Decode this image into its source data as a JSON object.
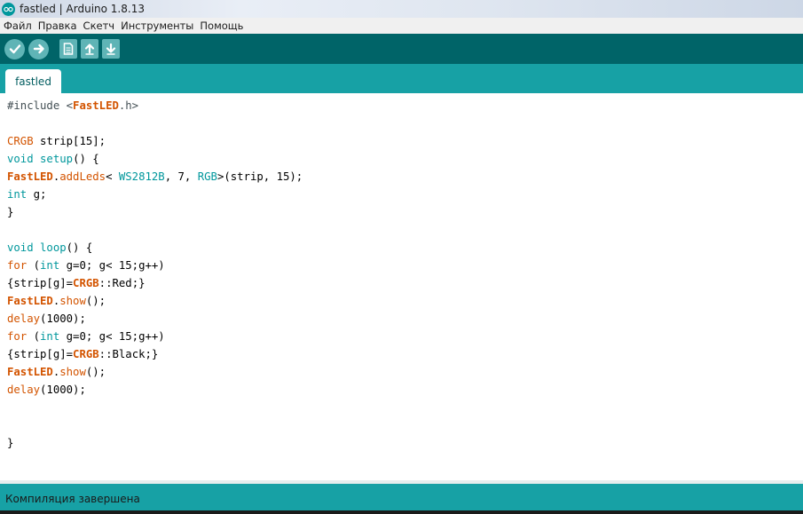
{
  "window": {
    "title": "fastled | Arduino 1.8.13"
  },
  "menu": {
    "items": [
      "Файл",
      "Правка",
      "Скетч",
      "Инструменты",
      "Помощь"
    ]
  },
  "toolbar": {
    "buttons": [
      {
        "name": "verify",
        "icon": "check-icon"
      },
      {
        "name": "upload",
        "icon": "arrow-right-icon"
      },
      {
        "name": "new",
        "icon": "new-file-icon"
      },
      {
        "name": "open",
        "icon": "arrow-up-icon"
      },
      {
        "name": "save",
        "icon": "arrow-down-icon"
      }
    ]
  },
  "tabs": [
    {
      "label": "fastled"
    }
  ],
  "code": {
    "lines": [
      "#include <FastLED.h>",
      "",
      "CRGB strip[15];",
      "void setup() {",
      "FastLED.addLeds< WS2812B, 7, RGB>(strip, 15);",
      "int g;",
      "}",
      "",
      "void loop() {",
      "for (int g=0; g< 15;g++)",
      "{strip[g]=CRGB::Red;}",
      "FastLED.show();",
      "delay(1000);",
      "for (int g=0; g< 15;g++)",
      "{strip[g]=CRGB::Black;}",
      "FastLED.show();",
      "delay(1000);",
      "",
      "",
      "}"
    ]
  },
  "status": {
    "message": "Компиляция завершена"
  },
  "colors": {
    "toolbar_bg": "#006468",
    "tabbar_bg": "#17a1a5",
    "keyword_orange": "#d35400",
    "keyword_teal": "#00979c"
  }
}
